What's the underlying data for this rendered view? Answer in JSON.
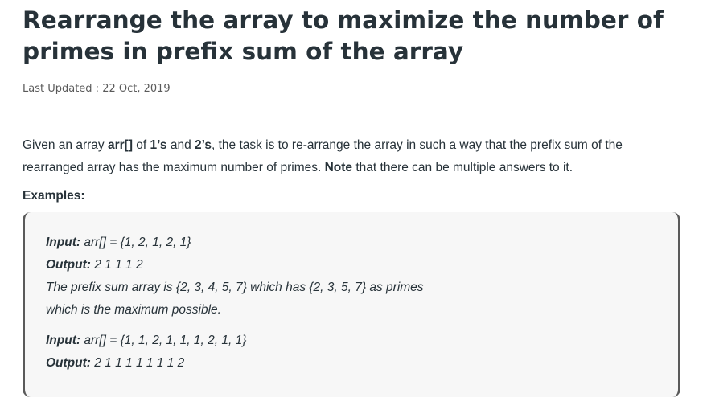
{
  "article": {
    "title": "Rearrange the array to maximize the number of primes in prefix sum of the array",
    "updated_label": "Last Updated : ",
    "updated_date": "22 Oct, 2019",
    "intro": {
      "t1": "Given an array ",
      "b1": "arr[]",
      "t2": " of ",
      "b2": "1’s",
      "t3": " and ",
      "b3": "2’s",
      "t4": ", the task is to re-arrange the array in such a way that the prefix sum of the rearranged array has the maximum number of primes. ",
      "b4": "Note",
      "t5": " that there can be multiple answers to it."
    },
    "examples_heading": "Examples:",
    "examples": [
      {
        "input_label": "Input:",
        "input_value": " arr[] = {1, 2, 1, 2, 1}",
        "output_label": "Output:",
        "output_value": " 2 1 1 1 2",
        "explanation_line1": "The prefix sum array is {2, 3, 4, 5, 7} which has {2, 3, 5, 7} as primes",
        "explanation_line2": "which is the maximum possible."
      },
      {
        "input_label": "Input:",
        "input_value": " arr[] = {1, 1, 2, 1, 1, 1, 2, 1, 1}",
        "output_label": "Output:",
        "output_value": " 2 1 1 1 1 1 1 1 2"
      }
    ]
  }
}
